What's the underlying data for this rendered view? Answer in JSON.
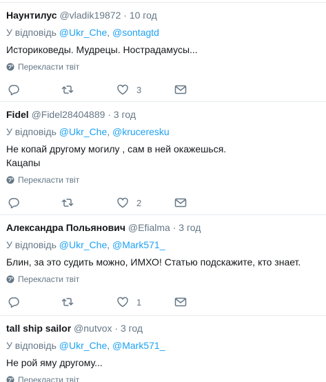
{
  "feed": {
    "tweets": [
      {
        "name": "Наунтилус",
        "handle": "@vladik19872",
        "time": "10 год",
        "reply_prefix": "У відповідь",
        "mentions": [
          "@Ukr_Che",
          "@sontagtd"
        ],
        "text_lines": [
          "Историковеды. Мудрецы. Нострадамусы..."
        ],
        "translate_label": "Перекласти твіт",
        "likes": "3"
      },
      {
        "name": "Fidel",
        "handle": "@Fidel28404889",
        "time": "3 год",
        "reply_prefix": "У відповідь",
        "mentions": [
          "@Ukr_Che",
          "@kruceresku"
        ],
        "text_lines": [
          "Не копай другому могилу , сам в ней окажешься.",
          "Кацапы"
        ],
        "translate_label": "Перекласти твіт",
        "likes": "2"
      },
      {
        "name": "Александра Польянович",
        "handle": "@Efialma",
        "time": "3 год",
        "reply_prefix": "У відповідь",
        "mentions": [
          "@Ukr_Che",
          "@Mark571_"
        ],
        "text_lines": [
          "Блин, за это судить можно, ИМХО! Статью подскажите, кто знает."
        ],
        "translate_label": "Перекласти твіт",
        "likes": "1"
      },
      {
        "name": "tall ship sailor",
        "handle": "@nutvox",
        "time": "3 год",
        "reply_prefix": "У відповідь",
        "mentions": [
          "@Ukr_Che",
          "@Mark571_"
        ],
        "text_lines": [
          "Не рой яму другому..."
        ],
        "translate_label": "Перекласти твіт",
        "likes": ""
      }
    ]
  },
  "colors": {
    "accent": "#1da1f2",
    "muted": "#657786",
    "text": "#14171a",
    "divider": "#e6ecf0"
  },
  "icons": {
    "reply": "reply-icon",
    "retweet": "retweet-icon",
    "like": "heart-icon",
    "dm": "envelope-icon",
    "translate": "globe-icon"
  }
}
